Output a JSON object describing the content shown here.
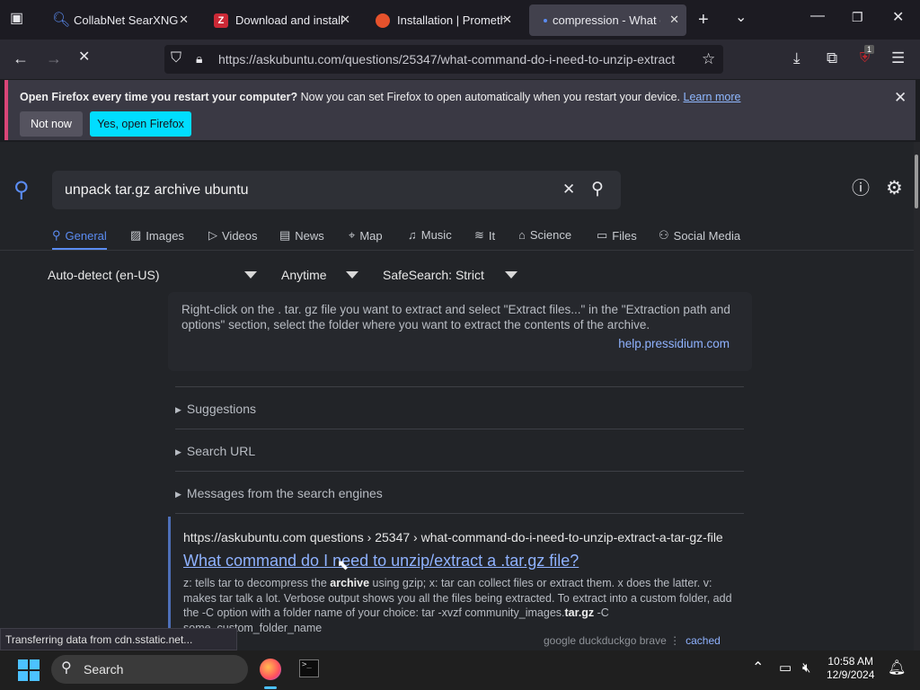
{
  "tabs": [
    {
      "title": "CollabNet SearXNG",
      "close": "✕"
    },
    {
      "title": "Download and install Z",
      "close": "✕"
    },
    {
      "title": "Installation | Promethe",
      "close": "✕"
    },
    {
      "title": "compression - What cc",
      "close": "✕"
    }
  ],
  "url": "https://askubuntu.com/questions/25347/what-command-do-i-need-to-unzip-extract",
  "notification": {
    "bold": "Open Firefox every time you restart your computer?",
    "text": " Now you can set Firefox to open automatically when you restart your device. ",
    "link": "Learn more",
    "not_now": "Not now",
    "yes": "Yes, open Firefox"
  },
  "search": {
    "query": "unpack tar.gz archive ubuntu"
  },
  "categories": [
    "General",
    "Images",
    "Videos",
    "News",
    "Map",
    "Music",
    "It",
    "Science",
    "Files",
    "Social Media"
  ],
  "filters": {
    "language": "Auto-detect (en-US)",
    "time": "Anytime",
    "safe": "SafeSearch: Strict"
  },
  "answer": {
    "text": "Right-click on the . tar. gz file you want to extract and select \"Extract files...\" in the \"Extraction path and options\" section, select the folder where you want to extract the contents of the archive.",
    "source": "help.pressidium.com"
  },
  "sections": [
    "Suggestions",
    "Search URL",
    "Messages from the search engines"
  ],
  "result": {
    "url": "https://askubuntu.com   questions › 25347 › what-command-do-i-need-to-unzip-extract-a-tar-gz-file",
    "title": "What command do I need to unzip/extract a .tar.gz file?",
    "snippet_1": "z: tells tar to decompress the ",
    "snippet_b1": "archive",
    "snippet_2": " using gzip; x: tar can collect files or extract them. x does the latter. v: makes tar talk a lot. Verbose output shows you all the files being extracted. To extract into a custom folder, add the -C option with a folder name of your choice: tar -xvzf community_images.",
    "snippet_b2": "tar.gz",
    "snippet_3": " -C some_custom_folder_name",
    "engines": "google   duckduckgo   brave   ⋮",
    "cached": "cached"
  },
  "status": "Transferring data from cdn.sstatic.net...",
  "taskbar": {
    "search": "Search",
    "time": "10:58 AM",
    "date": "12/9/2024"
  },
  "badge": "1"
}
